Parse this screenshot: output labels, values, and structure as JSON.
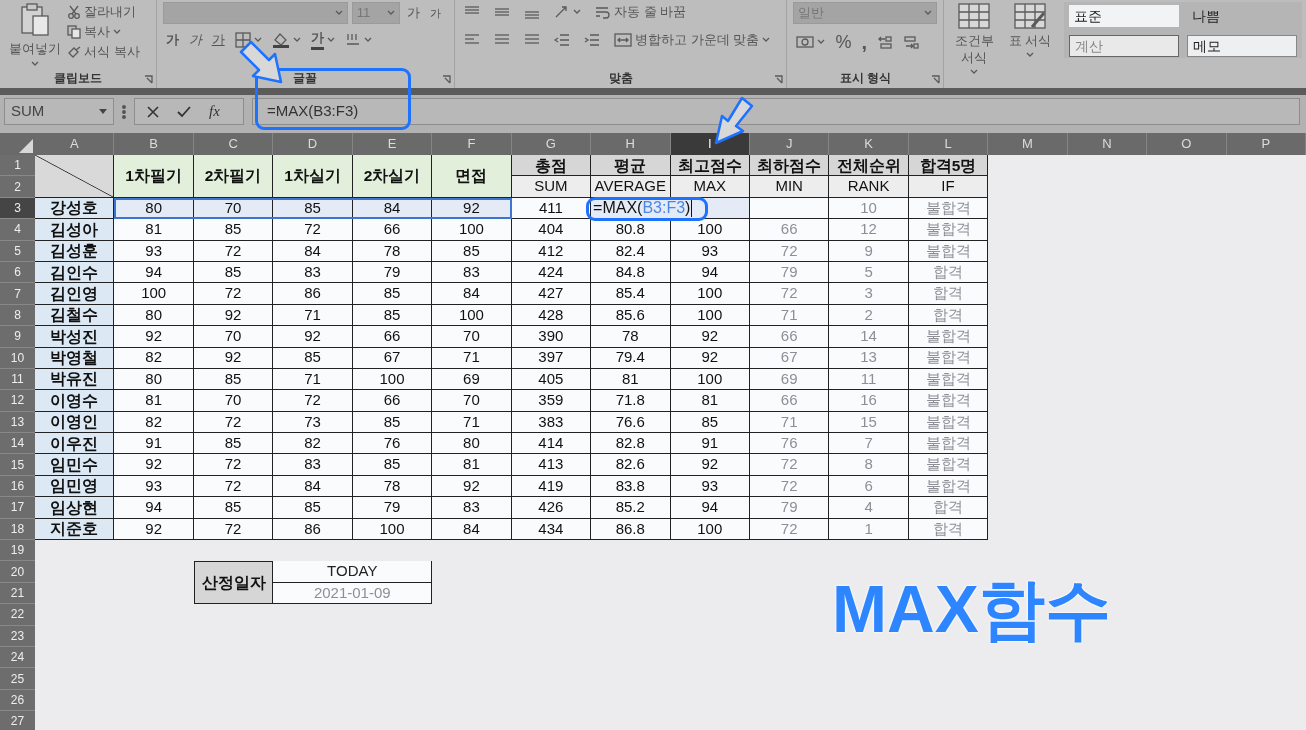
{
  "ribbon": {
    "clipboard": {
      "paste": "붙여넣기",
      "cut": "잘라내기",
      "copy": "복사",
      "format_painter": "서식 복사",
      "label": "클립보드"
    },
    "font": {
      "size": "11",
      "grow": "가",
      "shrink": "가",
      "bold": "가",
      "italic": "가",
      "underline": "가",
      "font_color": "가",
      "label": "글꼴"
    },
    "alignment": {
      "wrap": "자동 줄 바꿈",
      "merge": "병합하고 가운데 맞춤",
      "label": "맞춤"
    },
    "number": {
      "format": "일반",
      "percent": "%",
      "comma": ",",
      "label": "표시 형식"
    },
    "style_buttons": [
      "조건부 서식",
      "표 서식"
    ],
    "cell_styles": [
      {
        "label": "표준",
        "kind": "normal"
      },
      {
        "label": "나쁨",
        "kind": "bad"
      },
      {
        "label": "계산",
        "kind": "calculation"
      },
      {
        "label": "메모",
        "kind": "note"
      }
    ]
  },
  "formula_bar": {
    "name_box": "SUM",
    "fx": "fx",
    "formula": "=MAX(B3:F3)"
  },
  "sheet": {
    "columns": [
      {
        "label": "A",
        "selected": false
      },
      {
        "label": "B",
        "selected": false
      },
      {
        "label": "C",
        "selected": false
      },
      {
        "label": "D",
        "selected": false
      },
      {
        "label": "E",
        "selected": false
      },
      {
        "label": "F",
        "selected": false
      },
      {
        "label": "G",
        "selected": false
      },
      {
        "label": "H",
        "selected": false
      },
      {
        "label": "I",
        "selected": true
      },
      {
        "label": "J",
        "selected": false
      },
      {
        "label": "K",
        "selected": false
      },
      {
        "label": "L",
        "selected": false
      },
      {
        "label": "M",
        "selected": false
      },
      {
        "label": "N",
        "selected": false
      },
      {
        "label": "O",
        "selected": false
      },
      {
        "label": "P",
        "selected": false
      }
    ],
    "rows": [
      {
        "label": "1",
        "selected": false
      },
      {
        "label": "2",
        "selected": false
      },
      {
        "label": "3",
        "selected": true
      },
      {
        "label": "4",
        "selected": false
      },
      {
        "label": "5",
        "selected": false
      },
      {
        "label": "6",
        "selected": false
      },
      {
        "label": "7",
        "selected": false
      },
      {
        "label": "8",
        "selected": false
      },
      {
        "label": "9",
        "selected": false
      },
      {
        "label": "10",
        "selected": false
      },
      {
        "label": "11",
        "selected": false
      },
      {
        "label": "12",
        "selected": false
      },
      {
        "label": "13",
        "selected": false
      },
      {
        "label": "14",
        "selected": false
      },
      {
        "label": "15",
        "selected": false
      },
      {
        "label": "16",
        "selected": false
      },
      {
        "label": "17",
        "selected": false
      },
      {
        "label": "18",
        "selected": false
      },
      {
        "label": "19",
        "selected": false
      },
      {
        "label": "20",
        "selected": false
      },
      {
        "label": "21",
        "selected": false
      },
      {
        "label": "22",
        "selected": false
      },
      {
        "label": "23",
        "selected": false
      },
      {
        "label": "24",
        "selected": false
      },
      {
        "label": "25",
        "selected": false
      },
      {
        "label": "26",
        "selected": false
      },
      {
        "label": "27",
        "selected": false
      }
    ]
  },
  "table": {
    "headers": [
      {
        "title": "1차필기",
        "kind": "score",
        "dimmed": false
      },
      {
        "title": "2차필기",
        "kind": "score",
        "dimmed": false
      },
      {
        "title": "1차실기",
        "kind": "score",
        "dimmed": false
      },
      {
        "title": "2차실기",
        "kind": "score",
        "dimmed": false
      },
      {
        "title": "면접",
        "kind": "score",
        "dimmed": false
      },
      {
        "title": "총점",
        "subtitle": "SUM",
        "kind": "calc",
        "dimmed": false
      },
      {
        "title": "평균",
        "subtitle": "AVERAGE",
        "kind": "calc",
        "dimmed": false
      },
      {
        "title": "최고점수",
        "subtitle": "MAX",
        "kind": "calc",
        "dimmed": false
      },
      {
        "title": "최하점수",
        "subtitle": "MIN",
        "kind": "calc",
        "dimmed": true
      },
      {
        "title": "전체순위",
        "subtitle": "RANK",
        "kind": "calc",
        "dimmed": true
      },
      {
        "title": "합격5명",
        "subtitle": "IF",
        "kind": "calc",
        "dimmed": true
      }
    ],
    "rows": [
      {
        "name": "강성호",
        "selected": true,
        "cells": [
          "80",
          "70",
          "85",
          "84",
          "92",
          "411",
          null,
          null,
          null,
          "10",
          "불합격"
        ],
        "edit": {
          "prefix": "=MAX(",
          "reference": "B3:F3",
          "suffix": ")"
        }
      },
      {
        "name": "김성아",
        "selected": false,
        "cells": [
          "81",
          "85",
          "72",
          "66",
          "100",
          "404",
          "80.8",
          "100",
          "66",
          "12",
          "불합격"
        ]
      },
      {
        "name": "김성훈",
        "selected": false,
        "cells": [
          "93",
          "72",
          "84",
          "78",
          "85",
          "412",
          "82.4",
          "93",
          "72",
          "9",
          "불합격"
        ]
      },
      {
        "name": "김인수",
        "selected": false,
        "cells": [
          "94",
          "85",
          "83",
          "79",
          "83",
          "424",
          "84.8",
          "94",
          "79",
          "5",
          "합격"
        ]
      },
      {
        "name": "김인영",
        "selected": false,
        "cells": [
          "100",
          "72",
          "86",
          "85",
          "84",
          "427",
          "85.4",
          "100",
          "72",
          "3",
          "합격"
        ]
      },
      {
        "name": "김철수",
        "selected": false,
        "cells": [
          "80",
          "92",
          "71",
          "85",
          "100",
          "428",
          "85.6",
          "100",
          "71",
          "2",
          "합격"
        ]
      },
      {
        "name": "박성진",
        "selected": false,
        "cells": [
          "92",
          "70",
          "92",
          "66",
          "70",
          "390",
          "78",
          "92",
          "66",
          "14",
          "불합격"
        ]
      },
      {
        "name": "박영철",
        "selected": false,
        "cells": [
          "82",
          "92",
          "85",
          "67",
          "71",
          "397",
          "79.4",
          "92",
          "67",
          "13",
          "불합격"
        ]
      },
      {
        "name": "박유진",
        "selected": false,
        "cells": [
          "80",
          "85",
          "71",
          "100",
          "69",
          "405",
          "81",
          "100",
          "69",
          "11",
          "불합격"
        ]
      },
      {
        "name": "이영수",
        "selected": false,
        "cells": [
          "81",
          "70",
          "72",
          "66",
          "70",
          "359",
          "71.8",
          "81",
          "66",
          "16",
          "불합격"
        ]
      },
      {
        "name": "이영인",
        "selected": false,
        "cells": [
          "82",
          "72",
          "73",
          "85",
          "71",
          "383",
          "76.6",
          "85",
          "71",
          "15",
          "불합격"
        ]
      },
      {
        "name": "이우진",
        "selected": false,
        "cells": [
          "91",
          "85",
          "82",
          "76",
          "80",
          "414",
          "82.8",
          "91",
          "76",
          "7",
          "불합격"
        ]
      },
      {
        "name": "임민수",
        "selected": false,
        "cells": [
          "92",
          "72",
          "83",
          "85",
          "81",
          "413",
          "82.6",
          "92",
          "72",
          "8",
          "불합격"
        ]
      },
      {
        "name": "임민영",
        "selected": false,
        "cells": [
          "93",
          "72",
          "84",
          "78",
          "92",
          "419",
          "83.8",
          "93",
          "72",
          "6",
          "불합격"
        ]
      },
      {
        "name": "임상현",
        "selected": false,
        "cells": [
          "94",
          "85",
          "85",
          "79",
          "83",
          "426",
          "85.2",
          "94",
          "79",
          "4",
          "합격"
        ]
      },
      {
        "name": "지준호",
        "selected": false,
        "cells": [
          "92",
          "72",
          "86",
          "100",
          "84",
          "434",
          "86.8",
          "100",
          "72",
          "1",
          "합격"
        ]
      }
    ]
  },
  "date_box": {
    "label": "산정일자",
    "function": "TODAY",
    "value": "2021-01-09"
  },
  "annotation": {
    "title": "MAX함수"
  }
}
